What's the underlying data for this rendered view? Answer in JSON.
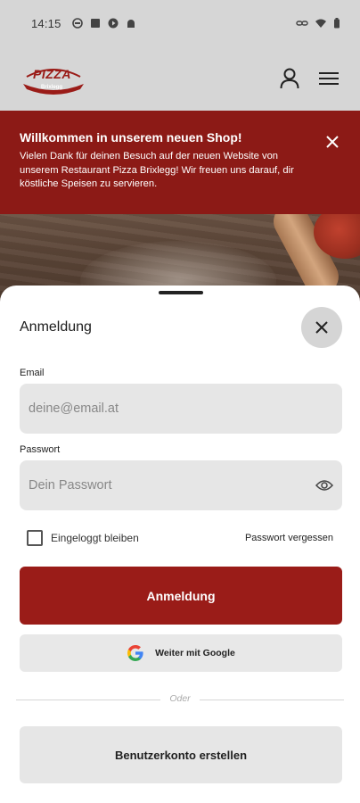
{
  "status_bar": {
    "time": "14:15"
  },
  "header": {
    "logo_text": "PIZZA",
    "logo_subtext": "Brixlegg",
    "icons": [
      "user-icon",
      "menu-icon"
    ]
  },
  "banner": {
    "title": "Willkommen in unserem neuen Shop!",
    "text": "Vielen Dank für deinen Besuch auf der neuen Website von unserem Restaurant Pizza Brixlegg! Wir freuen uns darauf, dir köstliche Speisen zu servieren."
  },
  "login": {
    "title": "Anmeldung",
    "email_label": "Email",
    "email_placeholder": "deine@email.at",
    "password_label": "Passwort",
    "password_placeholder": "Dein Passwort",
    "remember_label": "Eingeloggt bleiben",
    "forgot_label": "Passwort vergessen",
    "submit_label": "Anmeldung",
    "google_label": "Weiter mit Google",
    "divider_text": "Oder",
    "create_label": "Benutzerkonto erstellen"
  },
  "colors": {
    "brand_red": "#9a1c18",
    "banner_red": "#8c1a16",
    "header_bg": "#d6d6d6"
  }
}
